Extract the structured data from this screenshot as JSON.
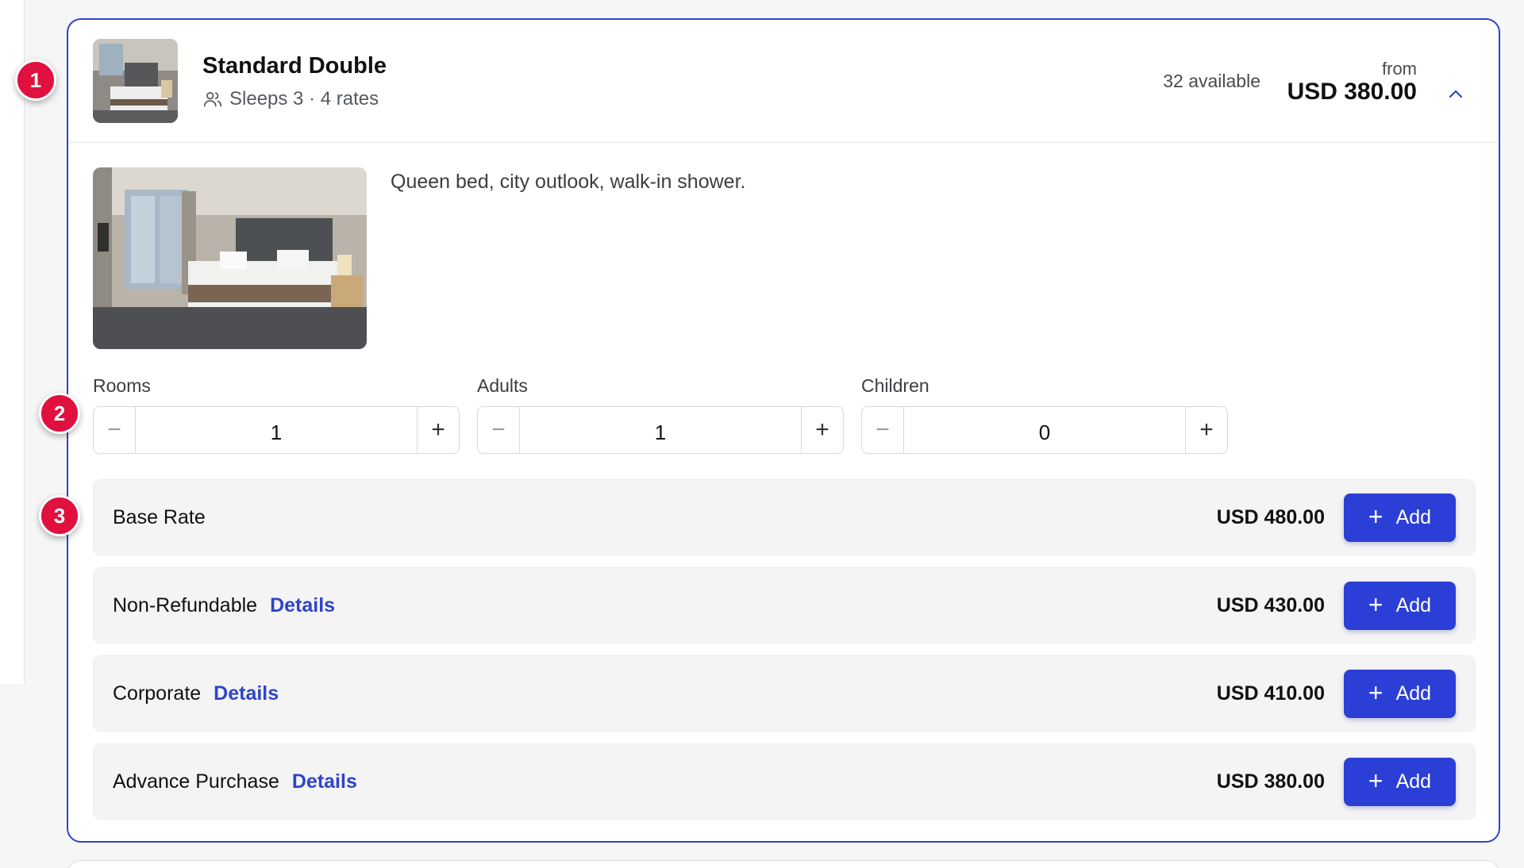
{
  "room": {
    "name": "Standard Double",
    "subtitle": "Sleeps 3 · 4 rates",
    "availability": "32 available",
    "from_label": "from",
    "from_price": "USD 380.00",
    "description": "Queen bed, city outlook, walk-in shower."
  },
  "steppers": [
    {
      "label": "Rooms",
      "value": "1",
      "minus": "−",
      "plus": "+"
    },
    {
      "label": "Adults",
      "value": "1",
      "minus": "−",
      "plus": "+"
    },
    {
      "label": "Children",
      "value": "0",
      "minus": "−",
      "plus": "+"
    }
  ],
  "rates": [
    {
      "name": "Base Rate",
      "details": "",
      "price": "USD 480.00",
      "add_label": "Add"
    },
    {
      "name": "Non-Refundable",
      "details": "Details",
      "price": "USD 430.00",
      "add_label": "Add"
    },
    {
      "name": "Corporate",
      "details": "Details",
      "price": "USD 410.00",
      "add_label": "Add"
    },
    {
      "name": "Advance Purchase",
      "details": "Details",
      "price": "USD 380.00",
      "add_label": "Add"
    }
  ],
  "markers": [
    "1",
    "2",
    "3"
  ],
  "colors": {
    "accent": "#2f44c9",
    "button": "#2b3fd6",
    "marker": "#e0103f"
  }
}
